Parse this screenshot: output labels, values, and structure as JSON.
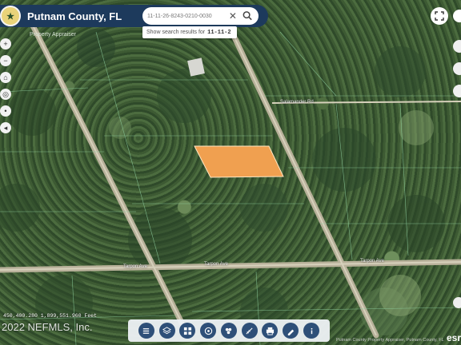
{
  "header": {
    "title": "Putnam County, FL",
    "subtitle": "Property Appraiser",
    "logo_icon": "county-seal-icon"
  },
  "search": {
    "value": "11-11-26-8243-0210-0030",
    "suggestion_prefix": "Show search results for",
    "suggestion_term": "11-11-2"
  },
  "road_labels": {
    "top_right": "Salamander Rd",
    "bottom_left": "Tarpon Ave",
    "bottom_mid": "Tarpon Ave",
    "bottom_right": "Tarpon Ave"
  },
  "status": {
    "coordinates": "450,400.280 1,899,551.960 Feet",
    "watermark": "2022 NEFMLS, Inc.",
    "attribution": "Putnam County Property Appraiser, Putnam County, FL",
    "powered_by": "esri"
  },
  "colors": {
    "header_bg": "#1d3a5c",
    "parcel_fill": "#f0a050",
    "toolbar_icon_bg": "#2e4f78"
  },
  "left_toolbar_icons": [
    "home-icon",
    "zoom-in-icon",
    "zoom-out-icon",
    "default-extent-icon",
    "locate-icon",
    "info-icon",
    "back-icon"
  ],
  "bottom_toolbar_icons": [
    "list-icon",
    "layers-icon",
    "grid-icon",
    "basemap-icon",
    "bookmark-icon",
    "measure-icon",
    "print-icon",
    "draw-icon",
    "about-icon"
  ]
}
